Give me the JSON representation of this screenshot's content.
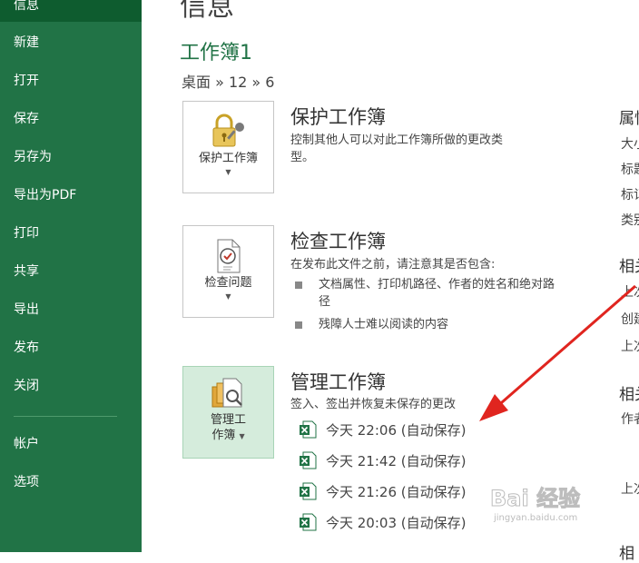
{
  "sidebar": {
    "items": [
      {
        "label": "信息"
      },
      {
        "label": "新建"
      },
      {
        "label": "打开"
      },
      {
        "label": "保存"
      },
      {
        "label": "另存为"
      },
      {
        "label": "导出为PDF"
      },
      {
        "label": "打印"
      },
      {
        "label": "共享"
      },
      {
        "label": "导出"
      },
      {
        "label": "发布"
      },
      {
        "label": "关闭"
      },
      {
        "label": "帐户"
      },
      {
        "label": "选项"
      }
    ]
  },
  "main": {
    "title": "信息",
    "workbook_name": "工作簿1",
    "breadcrumb": "桌面 » 12 » 6",
    "protect": {
      "button_label": "保护工作簿",
      "title": "保护工作簿",
      "desc_line1": "控制其他人可以对此工作簿所做的更改类",
      "desc_line2": "型。"
    },
    "inspect": {
      "button_label": "检查问题",
      "title": "检查工作簿",
      "desc": "在发布此文件之前，请注意其是否包含:",
      "bullets": [
        "文档属性、打印机路径、作者的姓名和绝对路径",
        "残障人士难以阅读的内容"
      ]
    },
    "manage": {
      "button_line1": "管理工",
      "button_line2": "作簿",
      "title": "管理工作簿",
      "desc": "签入、签出并恢复未保存的更改",
      "versions": [
        {
          "label": "今天 22:06 (自动保存)"
        },
        {
          "label": "今天 21:42 (自动保存)"
        },
        {
          "label": "今天 21:26 (自动保存)"
        },
        {
          "label": "今天 20:03 (自动保存)"
        }
      ]
    }
  },
  "right_panel": {
    "properties_title": "属性",
    "prop_lines": [
      "大小",
      "标题",
      "标记",
      "类别"
    ],
    "related_dates_title": "相关",
    "date_lines": [
      "上次",
      "创建",
      "上次"
    ],
    "related_people_title": "相关",
    "people_lines": [
      "作者",
      "上次"
    ],
    "bottom_title": "相"
  },
  "watermark": {
    "text": "Bai 经验",
    "url_text": "jingyan.baidu.com"
  },
  "colors": {
    "sidebar": "#217346",
    "accent": "#217346",
    "arrow": "#e0251f"
  }
}
